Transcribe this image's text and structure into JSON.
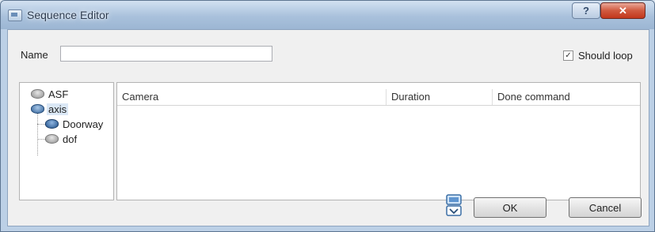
{
  "window": {
    "title": "Sequence Editor",
    "help_label": "?",
    "close_label": "✕"
  },
  "form": {
    "name_label": "Name",
    "name_value": "",
    "should_loop_label": "Should loop",
    "should_loop_checked": true
  },
  "tree": {
    "items": [
      {
        "label": "ASF"
      },
      {
        "label": "axis"
      },
      {
        "label": "Doorway"
      },
      {
        "label": "dof"
      }
    ]
  },
  "grid": {
    "columns": [
      "Camera",
      "Duration",
      "Done command"
    ],
    "rows": []
  },
  "buttons": {
    "ok_label": "OK",
    "cancel_label": "Cancel"
  },
  "icons": {
    "app": "sequence-editor-icon",
    "action": "sequence-action-icon"
  }
}
